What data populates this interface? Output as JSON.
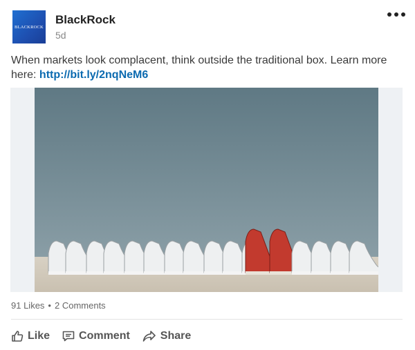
{
  "post": {
    "author": "BlackRock",
    "logo_text": "BLACKROCK",
    "age": "5d",
    "text": "When markets look complacent, think outside the traditional box. Learn more here: ",
    "link": "http://bit.ly/2nqNeM6"
  },
  "media": {
    "alt": "Row of white sneakers with one pair of red sneakers"
  },
  "stats": {
    "likes": "91 Likes",
    "separator": "•",
    "comments": "2 Comments"
  },
  "actions": {
    "like": "Like",
    "comment": "Comment",
    "share": "Share"
  },
  "colors": {
    "link": "#0b6ab0",
    "logo": "#1e4fb0",
    "accent_shoe": "#c23a2e"
  }
}
